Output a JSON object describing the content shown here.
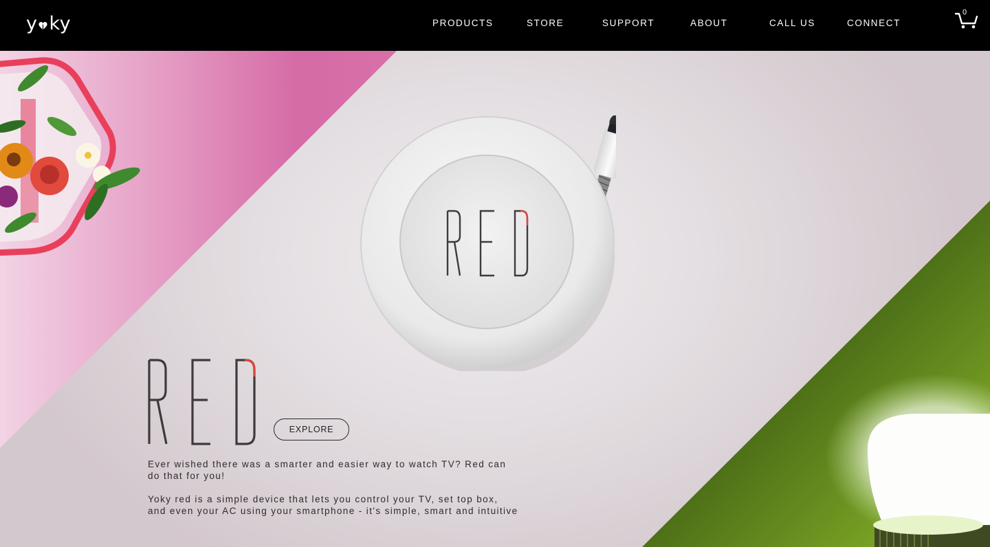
{
  "brand": {
    "logo": "yoky"
  },
  "nav": {
    "items": [
      {
        "label": "PRODUCTS"
      },
      {
        "label": "STORE"
      },
      {
        "label": "SUPPORT"
      },
      {
        "label": "ABOUT"
      },
      {
        "label": "CALL US"
      },
      {
        "label": "CONNECT"
      }
    ],
    "cart_count": "0"
  },
  "hero": {
    "device_label": "RED",
    "product_title": "RED",
    "explore_label": "EXPLORE",
    "description_1": "Ever wished there was a smarter and easier way to watch TV? Red can do that for you!",
    "description_2": "Yoky red is a simple device that lets you control your TV, set top box, and even your AC using your smartphone - it's simple, smart and intuitive"
  },
  "colors": {
    "nav_bg": "#000000",
    "accent_red": "#d9453f",
    "pink_panel": "#d870a8",
    "green_panel": "#6e9a1c",
    "text_dark": "#3d3a3c"
  }
}
